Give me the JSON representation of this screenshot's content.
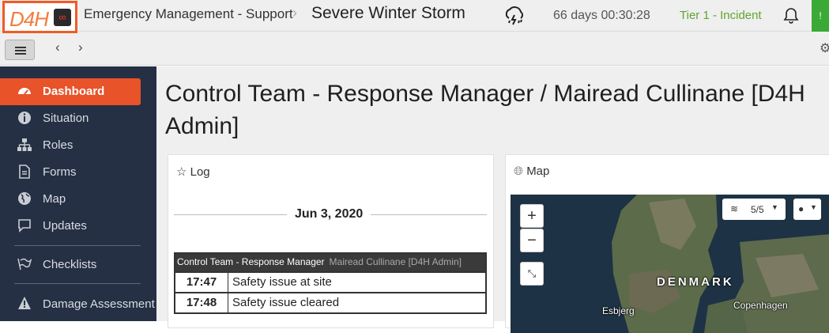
{
  "header": {
    "logo_text": "D4H",
    "app_title": "Emergency Management - Support",
    "incident_name": "Severe Winter Storm",
    "incident_icon": "storm-cloud-icon",
    "elapsed": "66 days 00:30:28",
    "tier": "Tier 1 - Incident",
    "tier_color": "#5fa62d",
    "brand_color": "#f15a24"
  },
  "sidebar": {
    "items": [
      {
        "label": "Dashboard",
        "icon": "dashboard-icon"
      },
      {
        "label": "Situation",
        "icon": "info-icon"
      },
      {
        "label": "Roles",
        "icon": "sitemap-icon"
      },
      {
        "label": "Forms",
        "icon": "document-icon"
      },
      {
        "label": "Map",
        "icon": "globe-icon"
      },
      {
        "label": "Updates",
        "icon": "chat-icon"
      },
      {
        "label": "Checklists",
        "icon": "checklist-icon"
      },
      {
        "label": "Damage Assessment",
        "icon": "warning-icon"
      }
    ]
  },
  "main": {
    "title": "Control Team - Response Manager / Mairead Cullinane [D4H Admin]"
  },
  "log": {
    "heading": "Log",
    "date": "Jun 3, 2020",
    "group_role": "Control Team - Response Manager",
    "group_user": "Mairead Cullinane [D4H Admin]",
    "entries": [
      {
        "time": "17:47",
        "message": "Safety issue at site"
      },
      {
        "time": "17:48",
        "message": "Safety issue cleared"
      }
    ]
  },
  "map": {
    "heading": "Map",
    "layers": "5/5",
    "zoom_in": "+",
    "zoom_out": "−",
    "labels": {
      "country": "DENMARK",
      "city1": "Copenhagen",
      "city2": "Esbjerg"
    }
  }
}
